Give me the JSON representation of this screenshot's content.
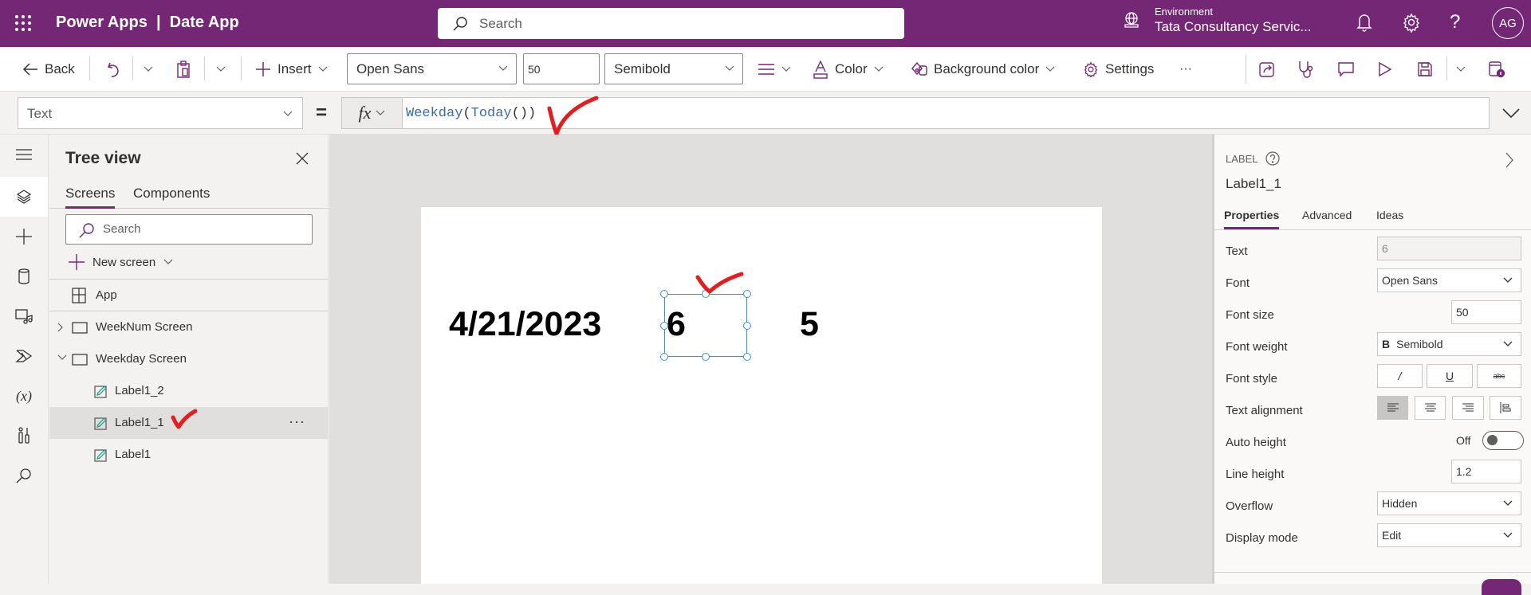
{
  "header": {
    "app_title": "Power Apps  |  Date App",
    "search_placeholder": "Search",
    "environment_label": "Environment",
    "environment_name": "Tata Consultancy Servic...",
    "avatar_initials": "AG",
    "brand_color": "#742774"
  },
  "toolbar": {
    "back_label": "Back",
    "insert_label": "Insert",
    "font_value": "Open Sans",
    "font_size_value": "50",
    "font_weight_value": "Semibold",
    "color_label": "Color",
    "background_color_label": "Background color",
    "settings_label": "Settings",
    "more_label": "···"
  },
  "formula_bar": {
    "property_value": "Text",
    "equals": "=",
    "fx_label": "fx",
    "formula_fn1": "Weekday",
    "formula_open1": "(",
    "formula_fn2": "Today",
    "formula_close": "())"
  },
  "tree_view": {
    "title": "Tree view",
    "tabs": [
      {
        "label": "Screens",
        "active": true
      },
      {
        "label": "Components",
        "active": false
      }
    ],
    "search_placeholder": "Search",
    "new_screen_label": "New screen",
    "items": [
      {
        "label": "App",
        "type": "app"
      },
      {
        "label": "WeekNum Screen",
        "type": "screen",
        "expanded": false
      },
      {
        "label": "Weekday Screen",
        "type": "screen",
        "expanded": true
      },
      {
        "label": "Label1_2",
        "type": "label"
      },
      {
        "label": "Label1_1",
        "type": "label",
        "selected": true
      },
      {
        "label": "Label1",
        "type": "label"
      }
    ],
    "more_label": "···"
  },
  "canvas": {
    "date_label": "4/21/2023",
    "weekday_label": "6",
    "weeknum_label": "5"
  },
  "properties_panel": {
    "kind": "LABEL",
    "control_name": "Label1_1",
    "tabs": [
      {
        "label": "Properties",
        "active": true
      },
      {
        "label": "Advanced",
        "active": false
      },
      {
        "label": "Ideas",
        "active": false
      }
    ],
    "rows": {
      "text_label": "Text",
      "text_value": "6",
      "font_label": "Font",
      "font_value": "Open Sans",
      "font_size_label": "Font size",
      "font_size_value": "50",
      "font_weight_label": "Font weight",
      "font_weight_icon": "B",
      "font_weight_value": "Semibold",
      "font_style_label": "Font style",
      "italic": "/",
      "underline": "U",
      "strike": "abc",
      "text_alignment_label": "Text alignment",
      "alignment_selected": "left",
      "auto_height_label": "Auto height",
      "auto_height_value": "Off",
      "line_height_label": "Line height",
      "line_height_value": "1.2",
      "overflow_label": "Overflow",
      "overflow_value": "Hidden",
      "display_mode_label": "Display mode",
      "display_mode_value": "Edit"
    }
  },
  "annotations": {
    "check_color": "#e02020"
  }
}
